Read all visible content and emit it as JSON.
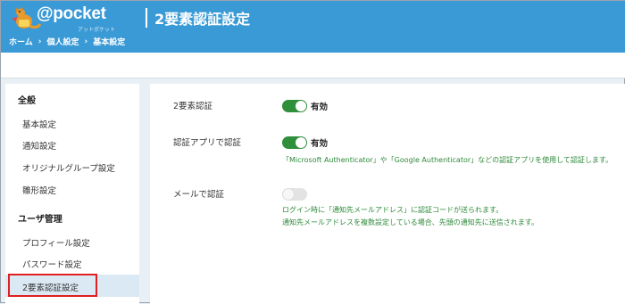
{
  "header": {
    "logo_text": "@pocket",
    "logo_sub": "アットポケット",
    "page_title": "2要素認証設定",
    "breadcrumb": [
      "ホーム",
      "個人設定",
      "基本設定"
    ],
    "breadcrumb_separator": "›"
  },
  "colors": {
    "header_bg": "#3a9ad6",
    "toggle_on": "#2f8f3a",
    "note_text": "#2d8a3a",
    "highlight_border": "#e02020",
    "active_item_bg": "#dbe9f4"
  },
  "sidebar": {
    "sections": [
      {
        "title": "全般",
        "items": [
          "基本設定",
          "通知設定",
          "オリジナルグループ設定",
          "雛形設定"
        ]
      },
      {
        "title": "ユーザ管理",
        "items": [
          "プロフィール設定",
          "パスワード設定",
          "2要素認証設定"
        ]
      }
    ],
    "active_item": "2要素認証設定"
  },
  "settings": [
    {
      "label": "2要素認証",
      "enabled": true,
      "status": "有効"
    },
    {
      "label": "認証アプリで認証",
      "enabled": true,
      "status": "有効",
      "note": "「Microsoft Authenticator」や「Google Authenticator」などの認証アプリを使用して認証します。"
    },
    {
      "label": "メールで認証",
      "enabled": false,
      "status": "",
      "note_lines": [
        "ログイン時に「通知先メールアドレス」に認証コードが送られます。",
        "通知先メールアドレスを複数設定している場合、先頭の通知先に送信されます。"
      ]
    }
  ]
}
